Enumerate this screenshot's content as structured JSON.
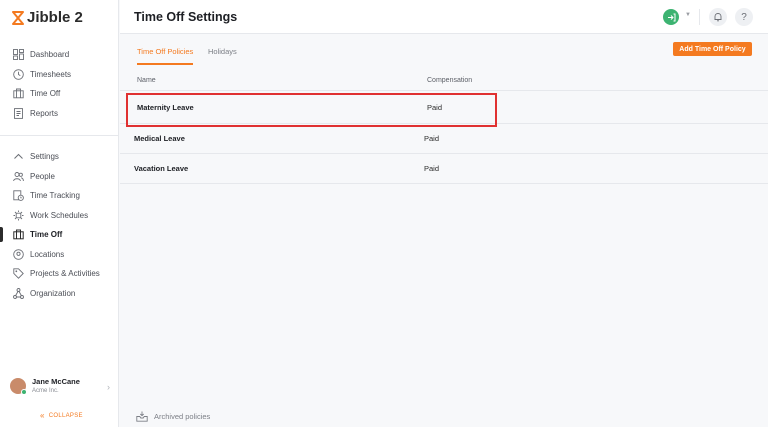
{
  "app": {
    "brand": "Jibble",
    "brand_version": "2",
    "accent": "#f47a20"
  },
  "sidebar": {
    "top_items": [
      {
        "label": "Dashboard",
        "icon": "dashboard-icon"
      },
      {
        "label": "Timesheets",
        "icon": "clock-icon"
      },
      {
        "label": "Time Off",
        "icon": "suitcase-icon"
      },
      {
        "label": "Reports",
        "icon": "report-icon"
      }
    ],
    "settings_label": "Settings",
    "settings_items": [
      {
        "label": "People",
        "icon": "people-icon"
      },
      {
        "label": "Time Tracking",
        "icon": "time-tracking-icon"
      },
      {
        "label": "Work Schedules",
        "icon": "schedule-icon"
      },
      {
        "label": "Time Off",
        "icon": "suitcase-icon",
        "active": true
      },
      {
        "label": "Locations",
        "icon": "location-icon"
      },
      {
        "label": "Projects & Activities",
        "icon": "tag-icon"
      },
      {
        "label": "Organization",
        "icon": "organization-icon"
      }
    ],
    "user": {
      "name": "Jane McCane",
      "org": "Acme Inc."
    },
    "collapse_label": "COLLAPSE"
  },
  "header": {
    "title": "Time Off Settings"
  },
  "tabs": [
    {
      "label": "Time Off Policies",
      "active": true
    },
    {
      "label": "Holidays",
      "active": false
    }
  ],
  "add_button_label": "Add Time Off Policy",
  "table": {
    "columns": [
      "Name",
      "Compensation"
    ],
    "rows": [
      {
        "name": "Maternity Leave",
        "compensation": "Paid"
      },
      {
        "name": "Medical Leave",
        "compensation": "Paid"
      },
      {
        "name": "Vacation Leave",
        "compensation": "Paid"
      }
    ]
  },
  "archived_label": "Archived policies"
}
